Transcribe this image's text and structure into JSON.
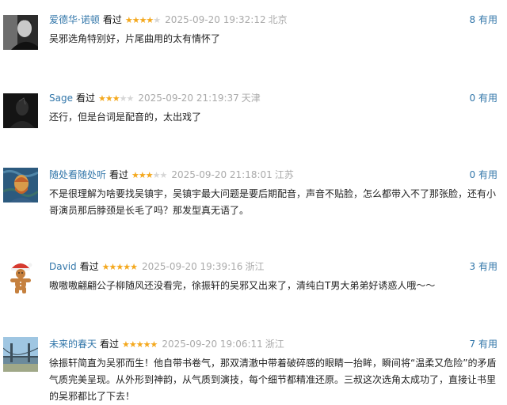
{
  "comments": [
    {
      "user": "爱德华·诺顿",
      "watched": "看过",
      "rating": 4,
      "time": "2025-09-20 19:32:12",
      "location": "北京",
      "votes": "8 有用",
      "text": "吴邪选角特别好，片尾曲用的太有情怀了",
      "avatar_icon": "man-portrait-dark"
    },
    {
      "user": "Sage",
      "watched": "看过",
      "rating": 3,
      "time": "2025-09-20 21:19:37",
      "location": "天津",
      "votes": "0 有用",
      "text": "还行，但是台词是配音的，太出戏了",
      "avatar_icon": "dark-silhouette"
    },
    {
      "user": "随处看随处听",
      "watched": "看过",
      "rating": 3,
      "time": "2025-09-20 21:18:01",
      "location": "江苏",
      "votes": "0 有用",
      "text": "不是很理解为啥要找吴镇宇，吴镇宇最大问题是要后期配音，声音不贴脸，怎么都带入不了那张脸，还有小哥演员那后脖颈是长毛了吗？那发型真无语了。",
      "avatar_icon": "van-gogh-painting"
    },
    {
      "user": "David",
      "watched": "看过",
      "rating": 5,
      "time": "2025-09-20 19:39:16",
      "location": "浙江",
      "votes": "3 有用",
      "text": "嗷嗷嗷翩翩公子柳随风还没看完，徐振轩的吴邪又出来了，清纯白T男大弟弟好诱惑人哦～～",
      "avatar_icon": "gingerbread-man"
    },
    {
      "user": "未来的春天",
      "watched": "看过",
      "rating": 5,
      "time": "2025-09-20 19:06:11",
      "location": "浙江",
      "votes": "7 有用",
      "text": "徐振轩简直为吴邪而生！他自带书卷气，那双清澈中带着破碎感的眼睛一抬眸，瞬间将“温柔又危险”的矛盾气质完美呈现。从外形到神韵，从气质到演技，每个细节都精准还原。三叔这次选角太成功了，直接让书里的吴邪都比了下去！",
      "avatar_icon": "bridge-landscape"
    }
  ]
}
